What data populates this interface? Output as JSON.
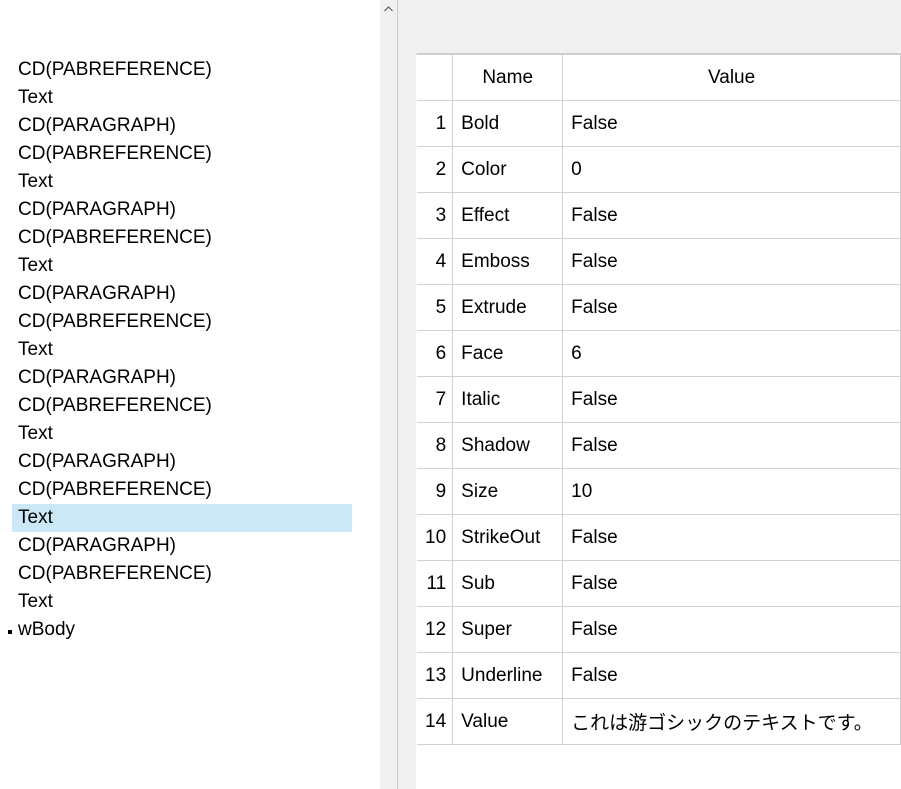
{
  "tree": {
    "items": [
      {
        "label": "CD(PABREFERENCE)",
        "bullet": false,
        "selected": false
      },
      {
        "label": "Text",
        "bullet": false,
        "selected": false
      },
      {
        "label": "CD(PARAGRAPH)",
        "bullet": false,
        "selected": false
      },
      {
        "label": "CD(PABREFERENCE)",
        "bullet": false,
        "selected": false
      },
      {
        "label": "Text",
        "bullet": false,
        "selected": false
      },
      {
        "label": "CD(PARAGRAPH)",
        "bullet": false,
        "selected": false
      },
      {
        "label": "CD(PABREFERENCE)",
        "bullet": false,
        "selected": false
      },
      {
        "label": "Text",
        "bullet": false,
        "selected": false
      },
      {
        "label": "CD(PARAGRAPH)",
        "bullet": false,
        "selected": false
      },
      {
        "label": "CD(PABREFERENCE)",
        "bullet": false,
        "selected": false
      },
      {
        "label": "Text",
        "bullet": false,
        "selected": false
      },
      {
        "label": "CD(PARAGRAPH)",
        "bullet": false,
        "selected": false
      },
      {
        "label": "CD(PABREFERENCE)",
        "bullet": false,
        "selected": false
      },
      {
        "label": "Text",
        "bullet": false,
        "selected": false
      },
      {
        "label": "CD(PARAGRAPH)",
        "bullet": false,
        "selected": false
      },
      {
        "label": "CD(PABREFERENCE)",
        "bullet": false,
        "selected": false
      },
      {
        "label": "Text",
        "bullet": false,
        "selected": true
      },
      {
        "label": "CD(PARAGRAPH)",
        "bullet": false,
        "selected": false
      },
      {
        "label": "CD(PABREFERENCE)",
        "bullet": false,
        "selected": false
      },
      {
        "label": "Text",
        "bullet": false,
        "selected": false
      },
      {
        "label": "wBody",
        "bullet": true,
        "selected": false
      }
    ]
  },
  "grid": {
    "headers": {
      "name": "Name",
      "value": "Value"
    },
    "rows": [
      {
        "n": "1",
        "name": "Bold",
        "value": "False"
      },
      {
        "n": "2",
        "name": "Color",
        "value": "0"
      },
      {
        "n": "3",
        "name": "Effect",
        "value": "False"
      },
      {
        "n": "4",
        "name": "Emboss",
        "value": "False"
      },
      {
        "n": "5",
        "name": "Extrude",
        "value": "False"
      },
      {
        "n": "6",
        "name": "Face",
        "value": "6"
      },
      {
        "n": "7",
        "name": "Italic",
        "value": "False"
      },
      {
        "n": "8",
        "name": "Shadow",
        "value": "False"
      },
      {
        "n": "9",
        "name": "Size",
        "value": "10"
      },
      {
        "n": "10",
        "name": "StrikeOut",
        "value": "False"
      },
      {
        "n": "11",
        "name": "Sub",
        "value": "False"
      },
      {
        "n": "12",
        "name": "Super",
        "value": "False"
      },
      {
        "n": "13",
        "name": "Underline",
        "value": "False"
      },
      {
        "n": "14",
        "name": "Value",
        "value": "これは游ゴシックのテキストです。"
      }
    ]
  }
}
